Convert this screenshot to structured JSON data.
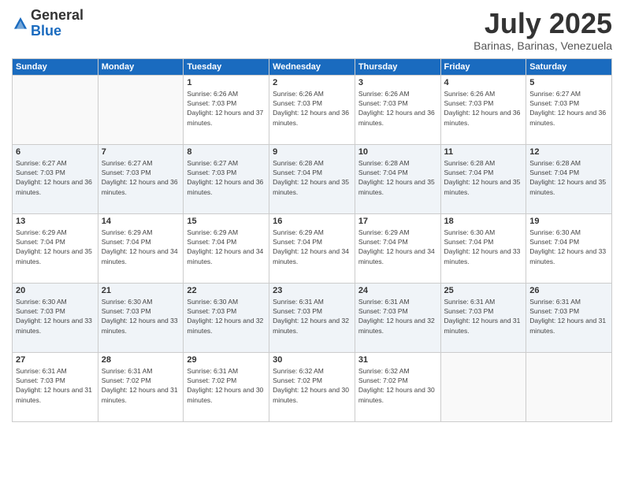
{
  "header": {
    "logo_general": "General",
    "logo_blue": "Blue",
    "month_title": "July 2025",
    "location": "Barinas, Barinas, Venezuela"
  },
  "weekdays": [
    "Sunday",
    "Monday",
    "Tuesday",
    "Wednesday",
    "Thursday",
    "Friday",
    "Saturday"
  ],
  "weeks": [
    [
      {
        "day": "",
        "sunrise": "",
        "sunset": "",
        "daylight": ""
      },
      {
        "day": "",
        "sunrise": "",
        "sunset": "",
        "daylight": ""
      },
      {
        "day": "1",
        "sunrise": "Sunrise: 6:26 AM",
        "sunset": "Sunset: 7:03 PM",
        "daylight": "Daylight: 12 hours and 37 minutes."
      },
      {
        "day": "2",
        "sunrise": "Sunrise: 6:26 AM",
        "sunset": "Sunset: 7:03 PM",
        "daylight": "Daylight: 12 hours and 36 minutes."
      },
      {
        "day": "3",
        "sunrise": "Sunrise: 6:26 AM",
        "sunset": "Sunset: 7:03 PM",
        "daylight": "Daylight: 12 hours and 36 minutes."
      },
      {
        "day": "4",
        "sunrise": "Sunrise: 6:26 AM",
        "sunset": "Sunset: 7:03 PM",
        "daylight": "Daylight: 12 hours and 36 minutes."
      },
      {
        "day": "5",
        "sunrise": "Sunrise: 6:27 AM",
        "sunset": "Sunset: 7:03 PM",
        "daylight": "Daylight: 12 hours and 36 minutes."
      }
    ],
    [
      {
        "day": "6",
        "sunrise": "Sunrise: 6:27 AM",
        "sunset": "Sunset: 7:03 PM",
        "daylight": "Daylight: 12 hours and 36 minutes."
      },
      {
        "day": "7",
        "sunrise": "Sunrise: 6:27 AM",
        "sunset": "Sunset: 7:03 PM",
        "daylight": "Daylight: 12 hours and 36 minutes."
      },
      {
        "day": "8",
        "sunrise": "Sunrise: 6:27 AM",
        "sunset": "Sunset: 7:03 PM",
        "daylight": "Daylight: 12 hours and 36 minutes."
      },
      {
        "day": "9",
        "sunrise": "Sunrise: 6:28 AM",
        "sunset": "Sunset: 7:04 PM",
        "daylight": "Daylight: 12 hours and 35 minutes."
      },
      {
        "day": "10",
        "sunrise": "Sunrise: 6:28 AM",
        "sunset": "Sunset: 7:04 PM",
        "daylight": "Daylight: 12 hours and 35 minutes."
      },
      {
        "day": "11",
        "sunrise": "Sunrise: 6:28 AM",
        "sunset": "Sunset: 7:04 PM",
        "daylight": "Daylight: 12 hours and 35 minutes."
      },
      {
        "day": "12",
        "sunrise": "Sunrise: 6:28 AM",
        "sunset": "Sunset: 7:04 PM",
        "daylight": "Daylight: 12 hours and 35 minutes."
      }
    ],
    [
      {
        "day": "13",
        "sunrise": "Sunrise: 6:29 AM",
        "sunset": "Sunset: 7:04 PM",
        "daylight": "Daylight: 12 hours and 35 minutes."
      },
      {
        "day": "14",
        "sunrise": "Sunrise: 6:29 AM",
        "sunset": "Sunset: 7:04 PM",
        "daylight": "Daylight: 12 hours and 34 minutes."
      },
      {
        "day": "15",
        "sunrise": "Sunrise: 6:29 AM",
        "sunset": "Sunset: 7:04 PM",
        "daylight": "Daylight: 12 hours and 34 minutes."
      },
      {
        "day": "16",
        "sunrise": "Sunrise: 6:29 AM",
        "sunset": "Sunset: 7:04 PM",
        "daylight": "Daylight: 12 hours and 34 minutes."
      },
      {
        "day": "17",
        "sunrise": "Sunrise: 6:29 AM",
        "sunset": "Sunset: 7:04 PM",
        "daylight": "Daylight: 12 hours and 34 minutes."
      },
      {
        "day": "18",
        "sunrise": "Sunrise: 6:30 AM",
        "sunset": "Sunset: 7:04 PM",
        "daylight": "Daylight: 12 hours and 33 minutes."
      },
      {
        "day": "19",
        "sunrise": "Sunrise: 6:30 AM",
        "sunset": "Sunset: 7:04 PM",
        "daylight": "Daylight: 12 hours and 33 minutes."
      }
    ],
    [
      {
        "day": "20",
        "sunrise": "Sunrise: 6:30 AM",
        "sunset": "Sunset: 7:03 PM",
        "daylight": "Daylight: 12 hours and 33 minutes."
      },
      {
        "day": "21",
        "sunrise": "Sunrise: 6:30 AM",
        "sunset": "Sunset: 7:03 PM",
        "daylight": "Daylight: 12 hours and 33 minutes."
      },
      {
        "day": "22",
        "sunrise": "Sunrise: 6:30 AM",
        "sunset": "Sunset: 7:03 PM",
        "daylight": "Daylight: 12 hours and 32 minutes."
      },
      {
        "day": "23",
        "sunrise": "Sunrise: 6:31 AM",
        "sunset": "Sunset: 7:03 PM",
        "daylight": "Daylight: 12 hours and 32 minutes."
      },
      {
        "day": "24",
        "sunrise": "Sunrise: 6:31 AM",
        "sunset": "Sunset: 7:03 PM",
        "daylight": "Daylight: 12 hours and 32 minutes."
      },
      {
        "day": "25",
        "sunrise": "Sunrise: 6:31 AM",
        "sunset": "Sunset: 7:03 PM",
        "daylight": "Daylight: 12 hours and 31 minutes."
      },
      {
        "day": "26",
        "sunrise": "Sunrise: 6:31 AM",
        "sunset": "Sunset: 7:03 PM",
        "daylight": "Daylight: 12 hours and 31 minutes."
      }
    ],
    [
      {
        "day": "27",
        "sunrise": "Sunrise: 6:31 AM",
        "sunset": "Sunset: 7:03 PM",
        "daylight": "Daylight: 12 hours and 31 minutes."
      },
      {
        "day": "28",
        "sunrise": "Sunrise: 6:31 AM",
        "sunset": "Sunset: 7:02 PM",
        "daylight": "Daylight: 12 hours and 31 minutes."
      },
      {
        "day": "29",
        "sunrise": "Sunrise: 6:31 AM",
        "sunset": "Sunset: 7:02 PM",
        "daylight": "Daylight: 12 hours and 30 minutes."
      },
      {
        "day": "30",
        "sunrise": "Sunrise: 6:32 AM",
        "sunset": "Sunset: 7:02 PM",
        "daylight": "Daylight: 12 hours and 30 minutes."
      },
      {
        "day": "31",
        "sunrise": "Sunrise: 6:32 AM",
        "sunset": "Sunset: 7:02 PM",
        "daylight": "Daylight: 12 hours and 30 minutes."
      },
      {
        "day": "",
        "sunrise": "",
        "sunset": "",
        "daylight": ""
      },
      {
        "day": "",
        "sunrise": "",
        "sunset": "",
        "daylight": ""
      }
    ]
  ]
}
